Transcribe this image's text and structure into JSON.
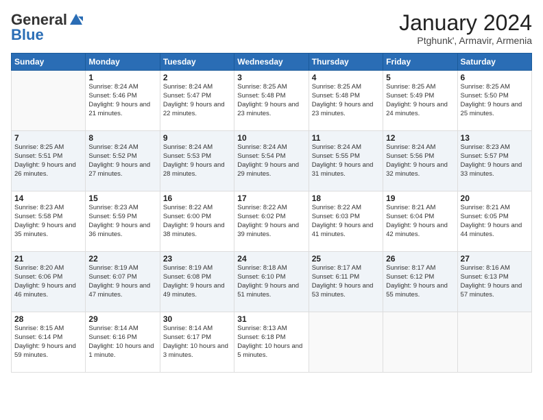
{
  "header": {
    "logo_general": "General",
    "logo_blue": "Blue",
    "month_title": "January 2024",
    "subtitle": "Ptghunk', Armavir, Armenia"
  },
  "weekdays": [
    "Sunday",
    "Monday",
    "Tuesday",
    "Wednesday",
    "Thursday",
    "Friday",
    "Saturday"
  ],
  "weeks": [
    [
      {
        "day": "",
        "sunrise": "",
        "sunset": "",
        "daylight": ""
      },
      {
        "day": "1",
        "sunrise": "Sunrise: 8:24 AM",
        "sunset": "Sunset: 5:46 PM",
        "daylight": "Daylight: 9 hours and 21 minutes."
      },
      {
        "day": "2",
        "sunrise": "Sunrise: 8:24 AM",
        "sunset": "Sunset: 5:47 PM",
        "daylight": "Daylight: 9 hours and 22 minutes."
      },
      {
        "day": "3",
        "sunrise": "Sunrise: 8:25 AM",
        "sunset": "Sunset: 5:48 PM",
        "daylight": "Daylight: 9 hours and 23 minutes."
      },
      {
        "day": "4",
        "sunrise": "Sunrise: 8:25 AM",
        "sunset": "Sunset: 5:48 PM",
        "daylight": "Daylight: 9 hours and 23 minutes."
      },
      {
        "day": "5",
        "sunrise": "Sunrise: 8:25 AM",
        "sunset": "Sunset: 5:49 PM",
        "daylight": "Daylight: 9 hours and 24 minutes."
      },
      {
        "day": "6",
        "sunrise": "Sunrise: 8:25 AM",
        "sunset": "Sunset: 5:50 PM",
        "daylight": "Daylight: 9 hours and 25 minutes."
      }
    ],
    [
      {
        "day": "7",
        "sunrise": "Sunrise: 8:25 AM",
        "sunset": "Sunset: 5:51 PM",
        "daylight": "Daylight: 9 hours and 26 minutes."
      },
      {
        "day": "8",
        "sunrise": "Sunrise: 8:24 AM",
        "sunset": "Sunset: 5:52 PM",
        "daylight": "Daylight: 9 hours and 27 minutes."
      },
      {
        "day": "9",
        "sunrise": "Sunrise: 8:24 AM",
        "sunset": "Sunset: 5:53 PM",
        "daylight": "Daylight: 9 hours and 28 minutes."
      },
      {
        "day": "10",
        "sunrise": "Sunrise: 8:24 AM",
        "sunset": "Sunset: 5:54 PM",
        "daylight": "Daylight: 9 hours and 29 minutes."
      },
      {
        "day": "11",
        "sunrise": "Sunrise: 8:24 AM",
        "sunset": "Sunset: 5:55 PM",
        "daylight": "Daylight: 9 hours and 31 minutes."
      },
      {
        "day": "12",
        "sunrise": "Sunrise: 8:24 AM",
        "sunset": "Sunset: 5:56 PM",
        "daylight": "Daylight: 9 hours and 32 minutes."
      },
      {
        "day": "13",
        "sunrise": "Sunrise: 8:23 AM",
        "sunset": "Sunset: 5:57 PM",
        "daylight": "Daylight: 9 hours and 33 minutes."
      }
    ],
    [
      {
        "day": "14",
        "sunrise": "Sunrise: 8:23 AM",
        "sunset": "Sunset: 5:58 PM",
        "daylight": "Daylight: 9 hours and 35 minutes."
      },
      {
        "day": "15",
        "sunrise": "Sunrise: 8:23 AM",
        "sunset": "Sunset: 5:59 PM",
        "daylight": "Daylight: 9 hours and 36 minutes."
      },
      {
        "day": "16",
        "sunrise": "Sunrise: 8:22 AM",
        "sunset": "Sunset: 6:00 PM",
        "daylight": "Daylight: 9 hours and 38 minutes."
      },
      {
        "day": "17",
        "sunrise": "Sunrise: 8:22 AM",
        "sunset": "Sunset: 6:02 PM",
        "daylight": "Daylight: 9 hours and 39 minutes."
      },
      {
        "day": "18",
        "sunrise": "Sunrise: 8:22 AM",
        "sunset": "Sunset: 6:03 PM",
        "daylight": "Daylight: 9 hours and 41 minutes."
      },
      {
        "day": "19",
        "sunrise": "Sunrise: 8:21 AM",
        "sunset": "Sunset: 6:04 PM",
        "daylight": "Daylight: 9 hours and 42 minutes."
      },
      {
        "day": "20",
        "sunrise": "Sunrise: 8:21 AM",
        "sunset": "Sunset: 6:05 PM",
        "daylight": "Daylight: 9 hours and 44 minutes."
      }
    ],
    [
      {
        "day": "21",
        "sunrise": "Sunrise: 8:20 AM",
        "sunset": "Sunset: 6:06 PM",
        "daylight": "Daylight: 9 hours and 46 minutes."
      },
      {
        "day": "22",
        "sunrise": "Sunrise: 8:19 AM",
        "sunset": "Sunset: 6:07 PM",
        "daylight": "Daylight: 9 hours and 47 minutes."
      },
      {
        "day": "23",
        "sunrise": "Sunrise: 8:19 AM",
        "sunset": "Sunset: 6:08 PM",
        "daylight": "Daylight: 9 hours and 49 minutes."
      },
      {
        "day": "24",
        "sunrise": "Sunrise: 8:18 AM",
        "sunset": "Sunset: 6:10 PM",
        "daylight": "Daylight: 9 hours and 51 minutes."
      },
      {
        "day": "25",
        "sunrise": "Sunrise: 8:17 AM",
        "sunset": "Sunset: 6:11 PM",
        "daylight": "Daylight: 9 hours and 53 minutes."
      },
      {
        "day": "26",
        "sunrise": "Sunrise: 8:17 AM",
        "sunset": "Sunset: 6:12 PM",
        "daylight": "Daylight: 9 hours and 55 minutes."
      },
      {
        "day": "27",
        "sunrise": "Sunrise: 8:16 AM",
        "sunset": "Sunset: 6:13 PM",
        "daylight": "Daylight: 9 hours and 57 minutes."
      }
    ],
    [
      {
        "day": "28",
        "sunrise": "Sunrise: 8:15 AM",
        "sunset": "Sunset: 6:14 PM",
        "daylight": "Daylight: 9 hours and 59 minutes."
      },
      {
        "day": "29",
        "sunrise": "Sunrise: 8:14 AM",
        "sunset": "Sunset: 6:16 PM",
        "daylight": "Daylight: 10 hours and 1 minute."
      },
      {
        "day": "30",
        "sunrise": "Sunrise: 8:14 AM",
        "sunset": "Sunset: 6:17 PM",
        "daylight": "Daylight: 10 hours and 3 minutes."
      },
      {
        "day": "31",
        "sunrise": "Sunrise: 8:13 AM",
        "sunset": "Sunset: 6:18 PM",
        "daylight": "Daylight: 10 hours and 5 minutes."
      },
      {
        "day": "",
        "sunrise": "",
        "sunset": "",
        "daylight": ""
      },
      {
        "day": "",
        "sunrise": "",
        "sunset": "",
        "daylight": ""
      },
      {
        "day": "",
        "sunrise": "",
        "sunset": "",
        "daylight": ""
      }
    ]
  ]
}
